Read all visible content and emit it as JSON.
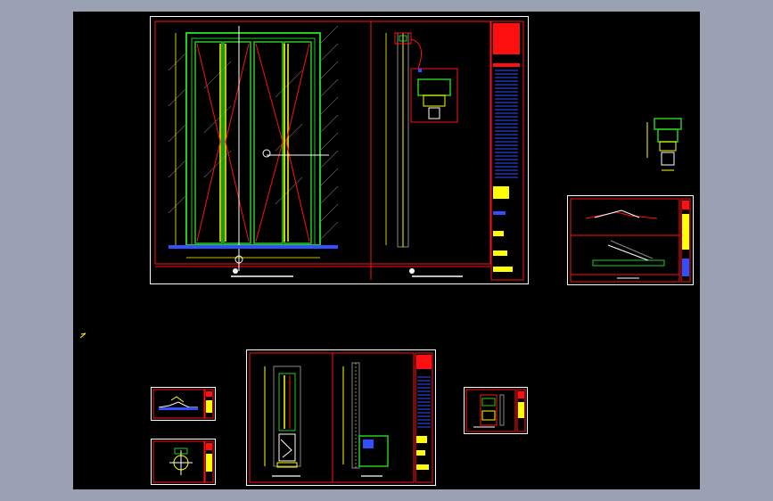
{
  "app": {
    "background": "#9aa1b2",
    "canvas": "#000000"
  },
  "colors": {
    "frame": "#ffffff",
    "red": "#ff1010",
    "green": "#22cc22",
    "yellow": "#ffff00",
    "cyan": "#00ffff",
    "blue": "#3050ff",
    "gray": "#888888"
  },
  "cursor": {
    "icon": "crosshair-cursor-icon"
  }
}
